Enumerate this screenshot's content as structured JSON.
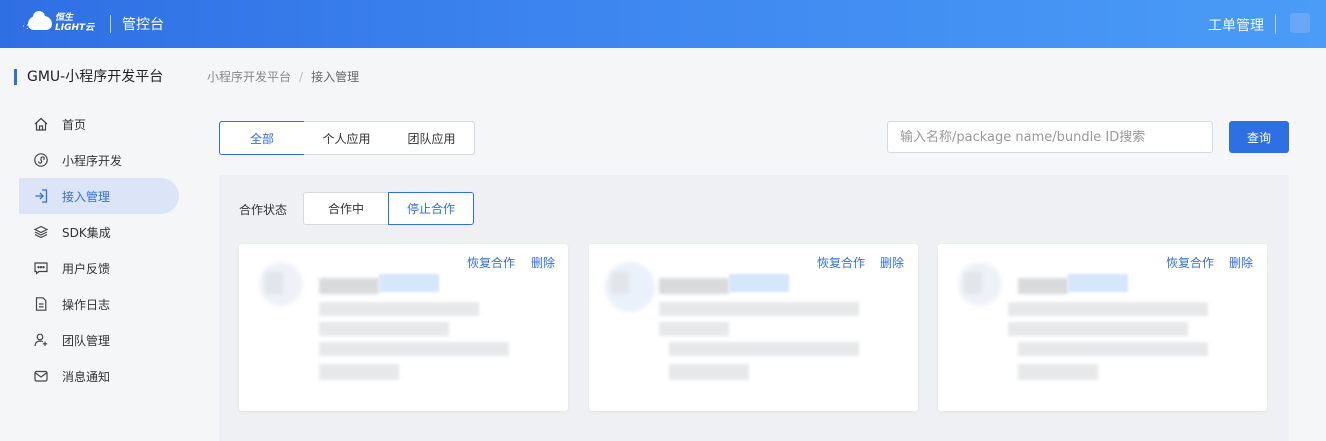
{
  "topbar": {
    "logo_line1": "恒生",
    "logo_line2": "LIGHT云",
    "title": "管控台",
    "ticket_link": "工单管理"
  },
  "sidebar": {
    "title": "GMU-小程序开发平台",
    "items": [
      {
        "label": "首页",
        "icon": "home-icon",
        "active": false
      },
      {
        "label": "小程序开发",
        "icon": "miniprogram-icon",
        "active": false
      },
      {
        "label": "接入管理",
        "icon": "access-icon",
        "active": true
      },
      {
        "label": "SDK集成",
        "icon": "layers-icon",
        "active": false
      },
      {
        "label": "用户反馈",
        "icon": "chat-icon",
        "active": false
      },
      {
        "label": "操作日志",
        "icon": "document-icon",
        "active": false
      },
      {
        "label": "团队管理",
        "icon": "team-icon",
        "active": false
      },
      {
        "label": "消息通知",
        "icon": "mail-icon",
        "active": false
      }
    ]
  },
  "breadcrumb": {
    "parent": "小程序开发平台",
    "separator": "/",
    "current": "接入管理"
  },
  "filter_tabs": [
    "全部",
    "个人应用",
    "团队应用"
  ],
  "search": {
    "placeholder": "输入名称/package name/bundle ID搜索",
    "button": "查询"
  },
  "status": {
    "label": "合作状态",
    "options": [
      "合作中",
      "停止合作"
    ],
    "selected": "停止合作"
  },
  "cards": [
    {
      "restore": "恢复合作",
      "delete": "删除"
    },
    {
      "restore": "恢复合作",
      "delete": "删除"
    },
    {
      "restore": "恢复合作",
      "delete": "删除"
    }
  ],
  "colors": {
    "accent": "#2f6fe4",
    "active_nav_bg": "#dbe5f7"
  }
}
